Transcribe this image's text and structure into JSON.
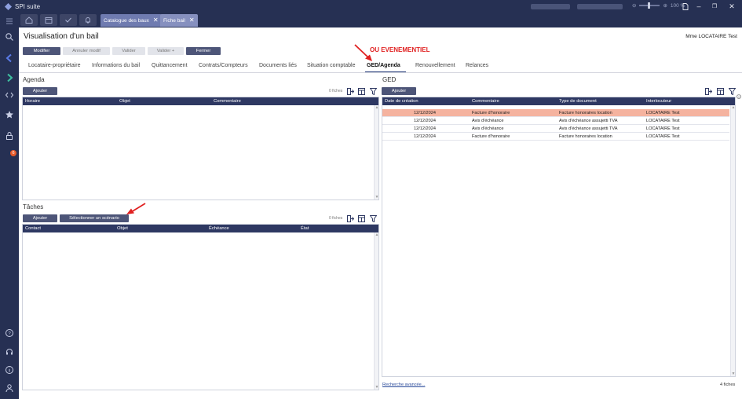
{
  "window": {
    "app_title": "SPI suite",
    "zoom": "100 %"
  },
  "tabs": [
    {
      "label": "Catalogue des baux"
    },
    {
      "label": "Fiche bail"
    }
  ],
  "sidebar": {
    "notification_count": "6"
  },
  "page": {
    "title": "Visualisation d'un bail",
    "user": "Mme LOCATAIRE Test"
  },
  "toolbar": {
    "modify": "Modifier",
    "cancel": "Annuler modif",
    "validate": "Valider",
    "validate_plus": "Valider +",
    "close": "Fermer"
  },
  "nav_tabs": [
    "Locataire-propriétaire",
    "Informations du bail",
    "Quittancement",
    "Contrats/Compteurs",
    "Documents liés",
    "Situation comptable",
    "GED/Agenda",
    "Renouvellement",
    "Relances"
  ],
  "annotation": "OU EVENEMENTIEL",
  "agenda": {
    "title": "Agenda",
    "add_button": "Ajouter",
    "count": "0 fiches",
    "columns": [
      "Horaire",
      "Objet",
      "Commentaire"
    ]
  },
  "tasks": {
    "title": "Tâches",
    "add_button": "Ajouter",
    "scenario_button": "Sélectionner un scénario",
    "count": "0 fiches",
    "columns": [
      "Contact",
      "Objet",
      "Échéance",
      "État"
    ]
  },
  "ged": {
    "title": "GED",
    "add_button": "Ajouter",
    "columns": [
      "Date de création",
      "Commentaire",
      "Type de document",
      "Interlocuteur"
    ],
    "rows": [
      {
        "date": "12/12/2024",
        "comment": "Facture d'honoraire",
        "type": "Facture honoraires location",
        "contact": "LOCATAIRE Test"
      },
      {
        "date": "12/12/2024",
        "comment": "Avis d'échéance",
        "type": "Avis d'échéance assujetti TVA",
        "contact": "LOCATAIRE Test"
      },
      {
        "date": "12/12/2024",
        "comment": "Avis d'échéance",
        "type": "Avis d'échéance assujetti TVA",
        "contact": "LOCATAIRE Test"
      },
      {
        "date": "12/12/2024",
        "comment": "Facture d'honoraire",
        "type": "Facture honoraires location",
        "contact": "LOCATAIRE Test"
      }
    ],
    "advanced_search": "Recherche avancée...",
    "footer_count": "4 fiches"
  },
  "colors": {
    "header": "#2e3862",
    "selected_row": "#f5b39f",
    "accent": "#243a7a",
    "annotation": "#e02020"
  }
}
